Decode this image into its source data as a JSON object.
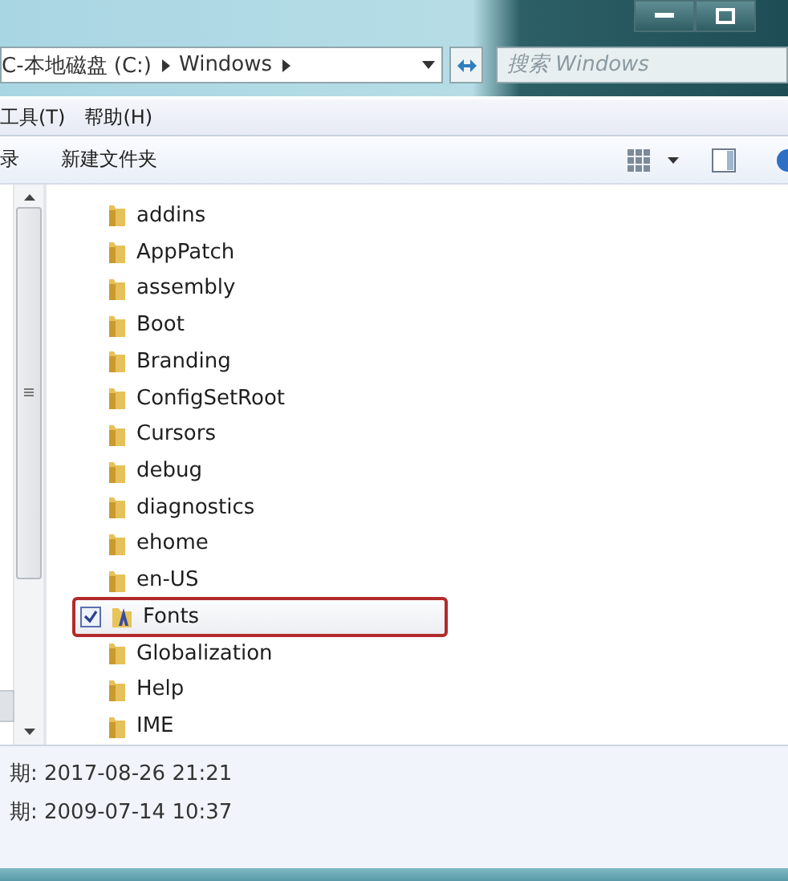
{
  "address_bar": {
    "crumbs": [
      "C-本地磁盘 (C:)",
      "Windows"
    ],
    "search": {
      "placeholder": "搜索 Windows"
    }
  },
  "menu_bar": [
    "工具(T)",
    "帮助(H)"
  ],
  "toolbar": {
    "items": [
      "录",
      "新建文件夹"
    ]
  },
  "files": [
    {
      "name": "addins",
      "selected": false,
      "highlighted": false,
      "kind": "folder"
    },
    {
      "name": "AppPatch",
      "selected": false,
      "highlighted": false,
      "kind": "folder"
    },
    {
      "name": "assembly",
      "selected": false,
      "highlighted": false,
      "kind": "folder"
    },
    {
      "name": "Boot",
      "selected": false,
      "highlighted": false,
      "kind": "folder"
    },
    {
      "name": "Branding",
      "selected": false,
      "highlighted": false,
      "kind": "folder"
    },
    {
      "name": "ConfigSetRoot",
      "selected": false,
      "highlighted": false,
      "kind": "folder"
    },
    {
      "name": "Cursors",
      "selected": false,
      "highlighted": false,
      "kind": "folder"
    },
    {
      "name": "debug",
      "selected": false,
      "highlighted": false,
      "kind": "folder"
    },
    {
      "name": "diagnostics",
      "selected": false,
      "highlighted": false,
      "kind": "folder"
    },
    {
      "name": "ehome",
      "selected": false,
      "highlighted": false,
      "kind": "folder"
    },
    {
      "name": "en-US",
      "selected": false,
      "highlighted": false,
      "kind": "folder"
    },
    {
      "name": "Fonts",
      "selected": true,
      "checked": true,
      "highlighted": true,
      "kind": "fonts"
    },
    {
      "name": "Globalization",
      "selected": false,
      "highlighted": false,
      "kind": "folder"
    },
    {
      "name": "Help",
      "selected": false,
      "highlighted": false,
      "kind": "folder"
    },
    {
      "name": "IME",
      "selected": false,
      "highlighted": false,
      "kind": "folder"
    }
  ],
  "details": [
    "期: 2017-08-26 21:21",
    "期: 2009-07-14 10:37"
  ]
}
